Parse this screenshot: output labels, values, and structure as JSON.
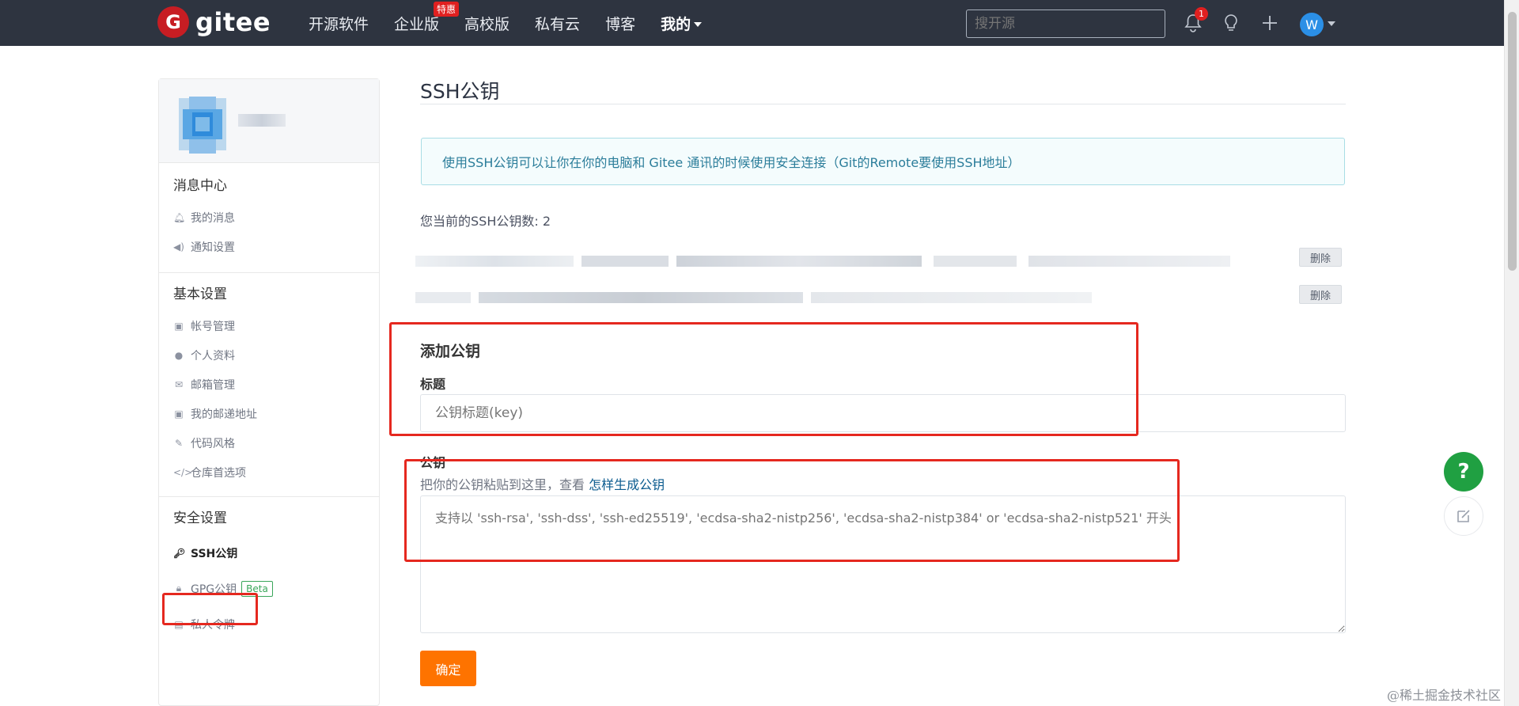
{
  "topbar": {
    "brand": "gitee",
    "logo_letter": "G",
    "nav": [
      "开源软件",
      "企业版",
      "高校版",
      "私有云",
      "博客"
    ],
    "enterprise_badge": "特惠",
    "mine": "我的",
    "search_placeholder": "搜开源",
    "notification_count": "1",
    "avatar_letter": "W",
    "icons": [
      "bell-icon",
      "lightbulb-icon",
      "plus-icon"
    ]
  },
  "sidebar": {
    "groups": [
      {
        "title": "消息中心",
        "items": [
          {
            "label": "我的消息",
            "icon": "bell-icon"
          },
          {
            "label": "通知设置",
            "icon": "speaker-icon"
          }
        ]
      },
      {
        "title": "基本设置",
        "items": [
          {
            "label": "帐号管理",
            "icon": "id-card-icon"
          },
          {
            "label": "个人资料",
            "icon": "user-icon"
          },
          {
            "label": "邮箱管理",
            "icon": "envelope-icon"
          },
          {
            "label": "我的邮递地址",
            "icon": "address-card-icon"
          },
          {
            "label": "代码风格",
            "icon": "brush-icon"
          },
          {
            "label": "仓库首选项",
            "icon": "code-icon"
          }
        ]
      },
      {
        "title": "安全设置",
        "items": [
          {
            "label": "SSH公钥",
            "icon": "key-icon",
            "active": true
          },
          {
            "label": "GPG公钥",
            "icon": "lock-icon",
            "badge": "Beta"
          },
          {
            "label": "私人令牌",
            "icon": "token-icon"
          }
        ]
      }
    ]
  },
  "main": {
    "title": "SSH公钥",
    "info": "使用SSH公钥可以让你在你的电脑和 Gitee 通讯的时候使用安全连接（Git的Remote要使用SSH地址）",
    "key_count_label": "您当前的SSH公钥数: 2",
    "delete_label": "删除",
    "add_title": "添加公钥",
    "title_label": "标题",
    "title_placeholder": "公钥标题(key)",
    "key_label": "公钥",
    "help_prefix": "把你的公钥粘贴到这里，查看 ",
    "help_link": "怎样生成公钥",
    "key_placeholder": "支持以 'ssh-rsa', 'ssh-dss', 'ssh-ed25519', 'ecdsa-sha2-nistp256', 'ecdsa-sha2-nistp384' or 'ecdsa-sha2-nistp521' 开头",
    "confirm_label": "确定"
  },
  "float": {
    "help": "?"
  },
  "watermark": "@稀土掘金技术社区",
  "colors": {
    "topbar": "#2e3440",
    "accent_orange": "#fe7300",
    "highlight_red": "#e5281f",
    "help_green": "#20a042"
  }
}
